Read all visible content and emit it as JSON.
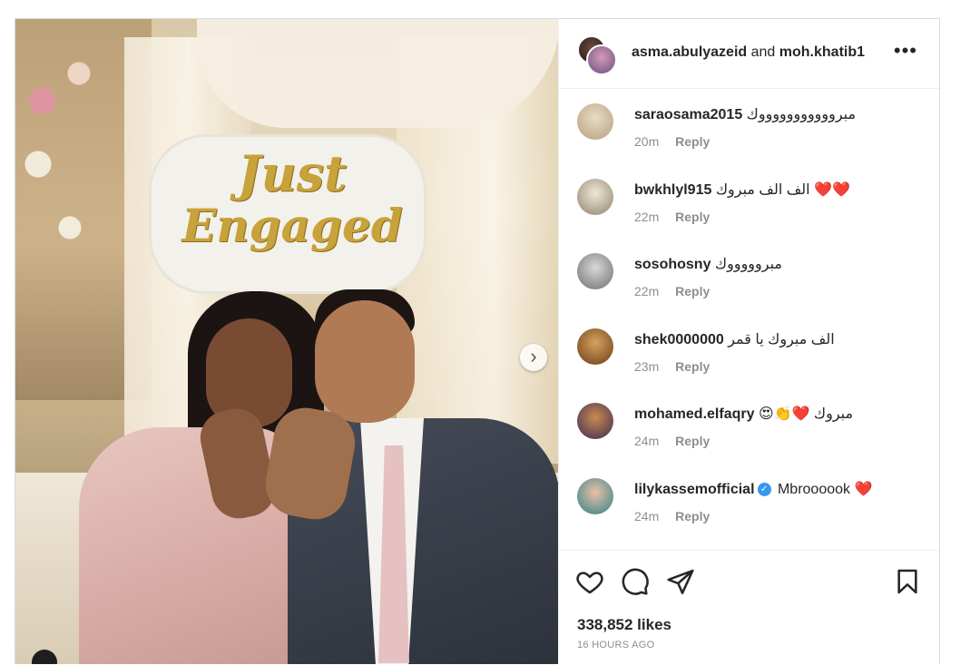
{
  "post": {
    "owners": {
      "first": "asma.abulyazeid",
      "connector": "and",
      "second": "moh.khatib1"
    },
    "more_icon": "more-horizontal-icon",
    "image": {
      "sign_line1": "Just",
      "sign_line2": "Engaged",
      "next_icon": "chevron-right-icon"
    },
    "comments": [
      {
        "user": "saraosama2015",
        "text": "مبروووووووووووك",
        "time": "20m",
        "reply": "Reply",
        "avatar_color": "#c9b79c"
      },
      {
        "user": "bwkhlyl915",
        "text": "الف الف مبروك ❤️❤️",
        "time": "22m",
        "reply": "Reply",
        "avatar_color": "#b9ae95"
      },
      {
        "user": "sosohosny",
        "text": "مبروووووك",
        "time": "22m",
        "reply": "Reply",
        "avatar_color": "#9a9a9a"
      },
      {
        "user": "shek0000000",
        "text": "الف مبروك يا قمر",
        "time": "23m",
        "reply": "Reply",
        "avatar_color": "#8a5a2a"
      },
      {
        "user": "mohamed.elfaqry",
        "text": "😍👏❤️ مبروك",
        "time": "24m",
        "reply": "Reply",
        "avatar_color": "#5a3d6a"
      },
      {
        "user": "lilykassemofficial",
        "text": "Mbroooook ❤️",
        "time": "24m",
        "reply": "Reply",
        "avatar_color": "#3d8c8f",
        "verified": true
      }
    ],
    "actions": {
      "like_icon": "heart-icon",
      "comment_icon": "comment-icon",
      "share_icon": "share-icon",
      "save_icon": "bookmark-icon"
    },
    "likes": "338,852 likes",
    "timestamp": "16 HOURS AGO"
  }
}
